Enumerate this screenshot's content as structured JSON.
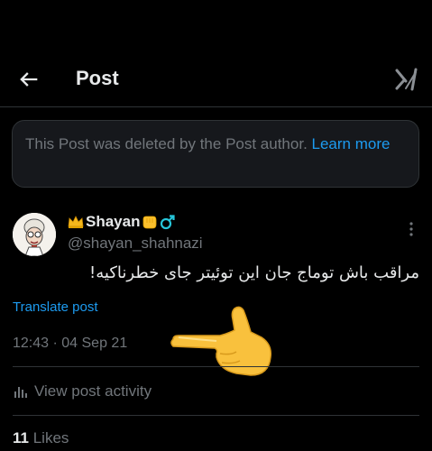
{
  "header": {
    "title": "Post",
    "back_icon": "arrow-left-icon",
    "grok_icon": "grok-icon"
  },
  "notice": {
    "text": "This Post was deleted by the Post author. ",
    "link": "Learn more"
  },
  "post": {
    "author_name": "Shayan",
    "name_emojis": [
      "crown",
      "oncoming-fist",
      "male-sign"
    ],
    "handle": "@shayan_shahnazi",
    "text": "مراقب باش توماج جان این توئیتر جای خطرناکیه!",
    "translate_label": "Translate post",
    "timestamp": "12:43 · 04 Sep 21",
    "activity_label": "View post activity",
    "likes_count": "11",
    "likes_label": "Likes"
  },
  "colors": {
    "background": "#000000",
    "text_primary": "#e7e9ea",
    "text_secondary": "#71767b",
    "accent": "#1d9bf0",
    "border": "#2f3336"
  }
}
